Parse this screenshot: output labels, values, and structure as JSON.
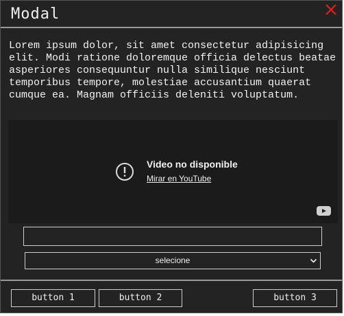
{
  "modal": {
    "title": "Modal",
    "body_text": "Lorem ipsum dolor, sit amet consectetur adipisicing elit. Modi ratione doloremque officia delectus beatae asperiores consequuntur nulla similique nesciunt temporibus tempore, molestiae accusantium quaerat cumque ea. Magnam officiis deleniti voluptatum."
  },
  "video": {
    "message": "Video no disponible",
    "link_label": "Mirar en YouTube"
  },
  "form": {
    "input_value": "",
    "select_value": "selecione"
  },
  "footer": {
    "button1_label": "button 1",
    "button2_label": "button 2",
    "button3_label": "button 3"
  },
  "colors": {
    "close": "#e02020",
    "background": "#232323"
  }
}
